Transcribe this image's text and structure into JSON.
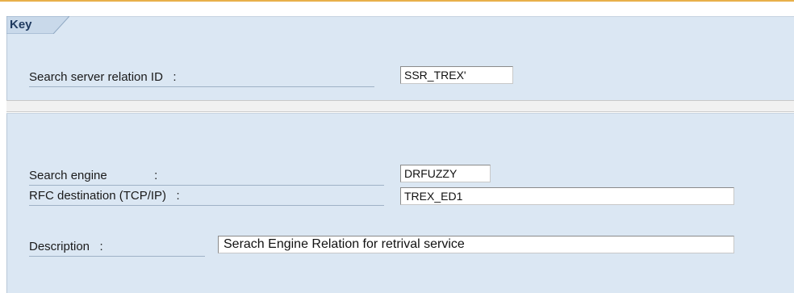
{
  "tabs": {
    "key_label": "Key"
  },
  "key_section": {
    "search_server_relation_label": "Search server relation ID   :",
    "search_server_relation_value": "SSR_TREX'"
  },
  "main_section": {
    "search_engine_label": "Search engine              :",
    "search_engine_value": "DRFUZZY",
    "rfc_destination_label": "RFC destination (TCP/IP)   :",
    "rfc_destination_value": "TREX_ED1",
    "description_label": "Description   :",
    "description_value": "Serach Engine Relation for retrival service"
  },
  "colors": {
    "panel_background": "#dbe7f3",
    "top_accent": "#e8b04a"
  }
}
